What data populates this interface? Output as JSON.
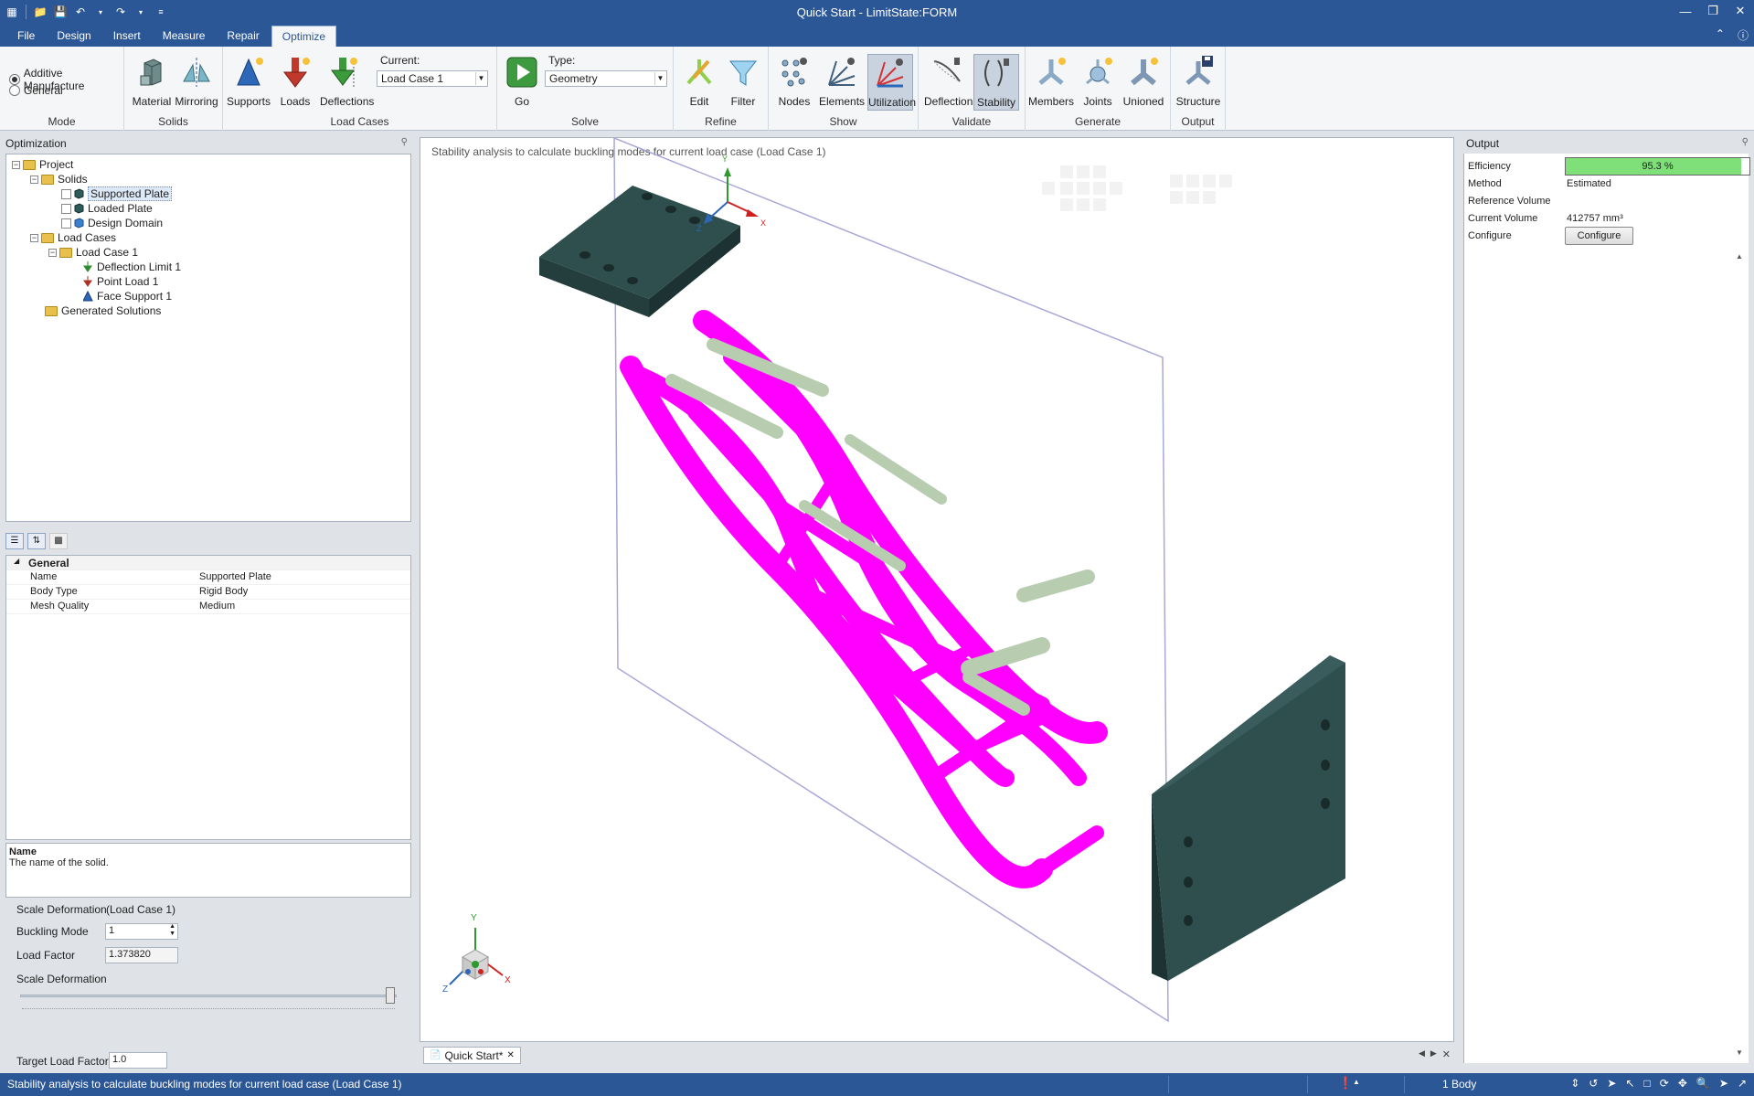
{
  "app": {
    "title": "Quick Start - LimitState:FORM"
  },
  "ribbon_tabs": [
    "File",
    "Design",
    "Insert",
    "Measure",
    "Repair",
    "Optimize"
  ],
  "ribbon": {
    "mode": {
      "label": "Mode",
      "options": [
        "Additive Manufacture",
        "General"
      ],
      "selected": "Additive Manufacture"
    },
    "solids": {
      "label": "Solids",
      "buttons": [
        "Material",
        "Mirroring"
      ]
    },
    "load_cases": {
      "label": "Load Cases",
      "buttons": [
        "Supports",
        "Loads",
        "Deflections"
      ],
      "current_label": "Current:",
      "current_value": "Load Case 1"
    },
    "solve": {
      "label": "Solve",
      "go": "Go",
      "type_label": "Type:",
      "type_value": "Geometry"
    },
    "refine": {
      "label": "Refine",
      "buttons": [
        "Edit",
        "Filter"
      ]
    },
    "show": {
      "label": "Show",
      "buttons": [
        "Nodes",
        "Elements",
        "Utilization"
      ]
    },
    "validate": {
      "label": "Validate",
      "buttons": [
        "Deflections",
        "Stability"
      ]
    },
    "generate": {
      "label": "Generate",
      "buttons": [
        "Members",
        "Joints",
        "Unioned"
      ]
    },
    "output": {
      "label": "Output",
      "buttons": [
        "Structure"
      ]
    }
  },
  "optimization_panel": {
    "title": "Optimization",
    "tree": {
      "project": "Project",
      "solids": "Solids",
      "solid_items": [
        "Supported Plate",
        "Loaded Plate",
        "Design Domain"
      ],
      "load_cases": "Load Cases",
      "load_case_1": "Load Case 1",
      "load_items": [
        "Deflection Limit 1",
        "Point Load 1",
        "Face Support 1"
      ],
      "generated": "Generated Solutions"
    }
  },
  "properties": {
    "section": "General",
    "rows": [
      {
        "key": "Name",
        "value": "Supported Plate"
      },
      {
        "key": "Body Type",
        "value": "Rigid Body"
      },
      {
        "key": "Mesh Quality",
        "value": "Medium"
      }
    ],
    "desc_title": "Name",
    "desc_text": "The name of the solid."
  },
  "stability": {
    "scale_def_label": "Scale Deformation",
    "scale_def_case": "(Load Case 1)",
    "buckling_mode_label": "Buckling Mode",
    "buckling_mode_value": "1",
    "load_factor_label": "Load Factor",
    "load_factor_value": "1.373820",
    "scale_slider_label": "Scale Deformation",
    "scale_slider_fraction": 1.0,
    "target_label": "Target Load Factor",
    "target_value": "1.0"
  },
  "viewport": {
    "message": "Stability analysis to calculate buckling modes for current load case (Load Case 1)",
    "axis_x": "X",
    "axis_y": "Y",
    "axis_z": "Z",
    "doc_tab": "Quick Start*"
  },
  "output_panel": {
    "title": "Output",
    "efficiency_label": "Efficiency",
    "efficiency_value": "95.3 %",
    "efficiency_fraction": 0.953,
    "method_label": "Method",
    "method_value": "Estimated",
    "ref_volume_label": "Reference Volume",
    "current_volume_label": "Current Volume",
    "current_volume_value": "412757 mm³",
    "configure_label": "Configure",
    "configure_button": "Configure"
  },
  "statusbar": {
    "message": "Stability analysis to calculate buckling modes for current load case (Load Case 1)",
    "bodies": "1 Body"
  },
  "colors": {
    "accent": "#2b5797",
    "structure": "#ff00ff",
    "plate": "#2f4f4f",
    "buckled": "#b8ccb0",
    "efficiency": "#7fe07a"
  }
}
